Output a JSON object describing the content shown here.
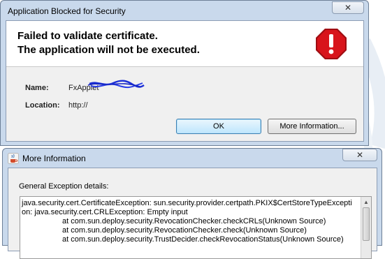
{
  "colors": {
    "title_bar": "#c9d9ec",
    "client_bg": "#f0f0f0",
    "stop_red": "#d8141b",
    "scribble_blue": "#1b2fd6"
  },
  "blocked_dialog": {
    "title": "Application Blocked for Security",
    "close_glyph": "✕",
    "heading_line1": "Failed to validate certificate.",
    "heading_line2": "The application will not be executed.",
    "icon": "stop-sign-exclamation-icon",
    "name_label": "Name:",
    "name_value": "FxApplet",
    "location_label": "Location:",
    "location_value": "http://",
    "ok_label": "OK",
    "more_info_label": "More Information..."
  },
  "more_info_dialog": {
    "title": "More Information",
    "close_glyph": "✕",
    "icon": "java-cup-icon",
    "section_label": "General Exception details:",
    "details_lines": [
      "java.security.cert.CertificateException: sun.security.provider.certpath.PKIX$CertStoreTypeExcepti",
      "on: java.security.cert.CRLException: Empty input",
      "\tat com.sun.deploy.security.RevocationChecker.checkCRLs(Unknown Source)",
      "\tat com.sun.deploy.security.RevocationChecker.check(Unknown Source)",
      "\tat com.sun.deploy.security.TrustDecider.checkRevocationStatus(Unknown Source)"
    ]
  }
}
